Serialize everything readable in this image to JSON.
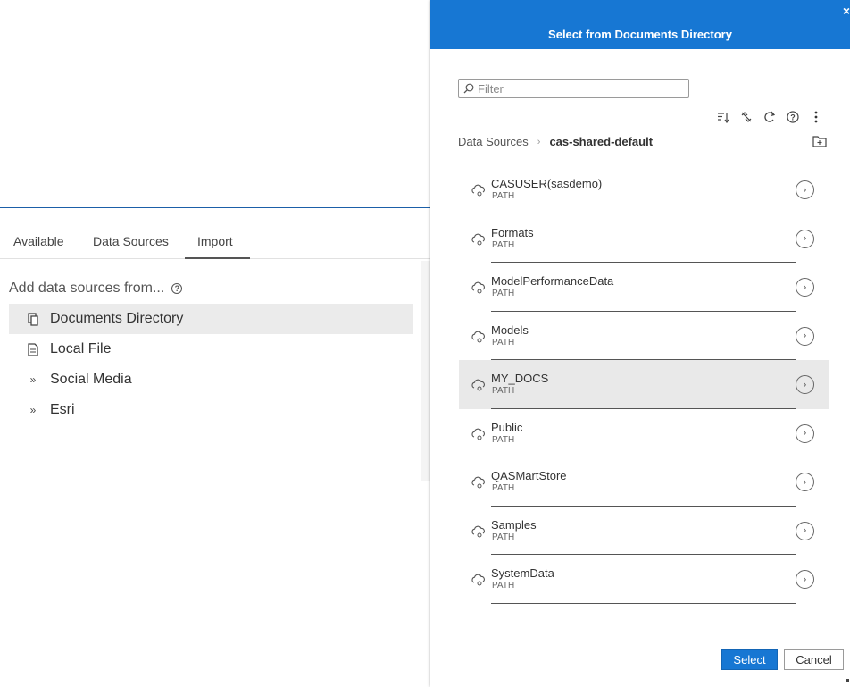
{
  "background": {
    "tabs": [
      {
        "label": "Available"
      },
      {
        "label": "Data Sources"
      },
      {
        "label": "Import"
      }
    ],
    "heading": "Add data sources from...",
    "help_icon": "help-icon",
    "sources": [
      {
        "label": "Documents Directory",
        "icon": "documents-icon",
        "selected": true
      },
      {
        "label": "Local File",
        "icon": "file-icon"
      },
      {
        "label": "Social Media",
        "icon": "double-chevron-icon"
      },
      {
        "label": "Esri",
        "icon": "double-chevron-icon"
      }
    ]
  },
  "dialog": {
    "title": "Select from Documents Directory",
    "close": "×",
    "filter": {
      "placeholder": "Filter",
      "value": ""
    },
    "toolbar": [
      "sort-icon",
      "unlink-icon",
      "refresh-icon",
      "help-icon",
      "more-icon"
    ],
    "breadcrumb": {
      "root": "Data Sources",
      "separator": "›",
      "current": "cas-shared-default"
    },
    "libraries": [
      {
        "name": "CASUSER(sasdemo)",
        "type": "PATH"
      },
      {
        "name": "Formats",
        "type": "PATH"
      },
      {
        "name": "ModelPerformanceData",
        "type": "PATH"
      },
      {
        "name": "Models",
        "type": "PATH"
      },
      {
        "name": "MY_DOCS",
        "type": "PATH",
        "highlighted": true
      },
      {
        "name": "Public",
        "type": "PATH"
      },
      {
        "name": "QASMartStore",
        "type": "PATH"
      },
      {
        "name": "Samples",
        "type": "PATH"
      },
      {
        "name": "SystemData",
        "type": "PATH"
      }
    ],
    "buttons": {
      "select": "Select",
      "cancel": "Cancel"
    }
  },
  "colors": {
    "accent": "#1777d3",
    "highlight": "#e9e9e9"
  }
}
